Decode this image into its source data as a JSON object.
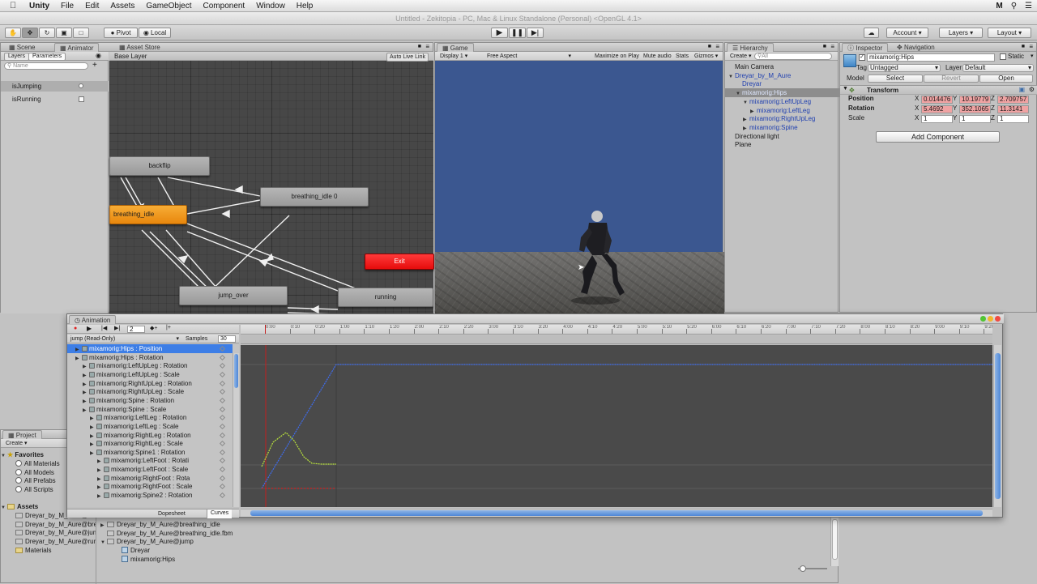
{
  "menubar": {
    "app_name": "Unity",
    "items": [
      "File",
      "Edit",
      "Assets",
      "GameObject",
      "Component",
      "Window",
      "Help"
    ],
    "right_icon": "M"
  },
  "window_title": "Untitled - Zekitopia - PC, Mac & Linux Standalone (Personal) <OpenGL 4.1>",
  "toolbar": {
    "pivot": "Pivot",
    "local": "Local",
    "account": "Account",
    "layers": "Layers",
    "layout": "Layout"
  },
  "colors": {
    "accent_orange": "#f09a1e",
    "exit_red": "#f01a1a",
    "sky_blue": "#3b5790",
    "selection_blue": "#3d7ee6",
    "position_curve_blue": "#3f6df0",
    "yellow_curve": "#b9e23c",
    "red_curve": "#d02020"
  },
  "animator": {
    "tab_scene": "Scene",
    "tab_animator": "Animator",
    "tab_asset_store": "Asset Store",
    "sub_layers": "Layers",
    "sub_parameters": "Parameters",
    "search_placeholder": "Name",
    "base_layer": "Base Layer",
    "auto_live_link": "Auto Live Link",
    "params": [
      {
        "name": "isJumping",
        "type": "trigger"
      },
      {
        "name": "isRunning",
        "type": "bool"
      }
    ],
    "nodes": {
      "backflip": "backflip",
      "breathing_idle0": "breathing_idle 0",
      "breathing_idle": "breathing_idle",
      "exit": "Exit",
      "jump_over": "jump_over",
      "running": "running"
    }
  },
  "game": {
    "tab": "Game",
    "display": "Display 1",
    "aspect": "Free Aspect",
    "maximize": "Maximize on Play",
    "mute": "Mute audio",
    "stats": "Stats",
    "gizmos": "Gizmos"
  },
  "hierarchy": {
    "tab": "Hierarchy",
    "create": "Create",
    "search": "All",
    "items": [
      {
        "label": "Main Camera",
        "indent": 0,
        "color": "dark"
      },
      {
        "label": "Dreyar_by_M_Aure",
        "indent": 0,
        "color": "blue",
        "arrow": "open"
      },
      {
        "label": "Dreyar",
        "indent": 1,
        "color": "blue"
      },
      {
        "label": "mixamorig:Hips",
        "indent": 1,
        "color": "blue",
        "arrow": "open",
        "selected": true
      },
      {
        "label": "mixamorig:LeftUpLeg",
        "indent": 2,
        "color": "blue",
        "arrow": "open"
      },
      {
        "label": "mixamorig:LeftLeg",
        "indent": 3,
        "color": "blue",
        "arrow": "closed"
      },
      {
        "label": "mixamorig:RightUpLeg",
        "indent": 2,
        "color": "blue",
        "arrow": "closed"
      },
      {
        "label": "mixamorig:Spine",
        "indent": 2,
        "color": "blue",
        "arrow": "closed"
      },
      {
        "label": "Directional light",
        "indent": 0,
        "color": "dark"
      },
      {
        "label": "Plane",
        "indent": 0,
        "color": "dark"
      }
    ]
  },
  "inspector": {
    "tab": "Inspector",
    "tab2": "Navigation",
    "name": "mixamorig:Hips",
    "static": "Static",
    "tag_label": "Tag",
    "tag": "Untagged",
    "layer_label": "Layer",
    "layer": "Default",
    "model_label": "Model",
    "select": "Select",
    "revert": "Revert",
    "open": "Open",
    "transform": "Transform",
    "position": {
      "label": "Position",
      "x": "0.014476",
      "y": "10.19779",
      "z": "2.709757"
    },
    "rotation": {
      "label": "Rotation",
      "x": "5.4692",
      "y": "352.1065",
      "z": "11.3141"
    },
    "scale": {
      "label": "Scale",
      "x": "1",
      "y": "1",
      "z": "1"
    },
    "add_component": "Add Component"
  },
  "animation": {
    "tab": "Animation",
    "frame": "2",
    "clip": "jump (Read-Only)",
    "samples_label": "Samples",
    "samples": "30",
    "dopesheet": "Dopesheet",
    "curves": "Curves",
    "timeline_ticks": [
      "0:00",
      "0:10",
      "0:20",
      "1:00",
      "1:10",
      "1:20",
      "2:00",
      "2:10",
      "2:20",
      "3:00",
      "3:10",
      "3:20",
      "4:00",
      "4:10",
      "4:20",
      "5:00",
      "5:10",
      "5:20",
      "6:00",
      "6:10",
      "6:20",
      "7:00",
      "7:10",
      "7:20",
      "8:00",
      "8:10",
      "8:20",
      "9:00",
      "9:10",
      "9:20"
    ],
    "properties": [
      {
        "label": "mixamorig:Hips : Position",
        "indent": 0,
        "selected": true
      },
      {
        "label": "mixamorig:Hips : Rotation",
        "indent": 0
      },
      {
        "label": "mixamorig:LeftUpLeg : Rotation",
        "indent": 1
      },
      {
        "label": "mixamorig:LeftUpLeg : Scale",
        "indent": 1
      },
      {
        "label": "mixamorig:RightUpLeg : Rotation",
        "indent": 1
      },
      {
        "label": "mixamorig:RightUpLeg : Scale",
        "indent": 1
      },
      {
        "label": "mixamorig:Spine : Rotation",
        "indent": 1
      },
      {
        "label": "mixamorig:Spine : Scale",
        "indent": 1
      },
      {
        "label": "mixamorig:LeftLeg : Rotation",
        "indent": 2
      },
      {
        "label": "mixamorig:LeftLeg : Scale",
        "indent": 2
      },
      {
        "label": "mixamorig:RightLeg : Rotation",
        "indent": 2
      },
      {
        "label": "mixamorig:RightLeg : Scale",
        "indent": 2
      },
      {
        "label": "mixamorig:Spine1 : Rotation",
        "indent": 2
      },
      {
        "label": "mixamorig:LeftFoot : Rotati",
        "indent": 3
      },
      {
        "label": "mixamorig:LeftFoot : Scale",
        "indent": 3
      },
      {
        "label": "mixamorig:RightFoot : Rota",
        "indent": 3
      },
      {
        "label": "mixamorig:RightFoot : Scale",
        "indent": 3
      },
      {
        "label": "mixamorig:Spine2 : Rotation",
        "indent": 3
      }
    ]
  },
  "project": {
    "tab": "Project",
    "create": "Create",
    "favorites": "Favorites",
    "favorite_items": [
      "All Materials",
      "All Models",
      "All Prefabs",
      "All Scripts"
    ],
    "assets": "Assets",
    "asset_items": [
      "Dreyar_by_M_Aure@bac",
      "Dreyar_by_M_Aure@bre",
      "Dreyar_by_M_Aure@jum",
      "Dreyar_by_M_Aure@run",
      "Materials"
    ],
    "content_items": [
      {
        "label": "Dreyar_by_M_Aure@breathing_idle",
        "indent": 0,
        "arrow": "closed"
      },
      {
        "label": "Dreyar_by_M_Aure@breathing_idle.fbm",
        "indent": 0
      },
      {
        "label": "Dreyar_by_M_Aure@jump",
        "indent": 0,
        "arrow": "open"
      },
      {
        "label": "Dreyar",
        "indent": 1
      },
      {
        "label": "mixamorig:Hips",
        "indent": 1
      }
    ]
  }
}
